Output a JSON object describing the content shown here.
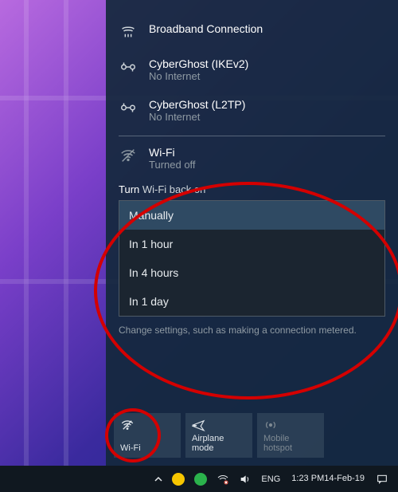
{
  "networks": [
    {
      "name": "Broadband Connection",
      "status": ""
    },
    {
      "name": "CyberGhost (IKEv2)",
      "status": "No Internet"
    },
    {
      "name": "CyberGhost (L2TP)",
      "status": "No Internet"
    }
  ],
  "wifi": {
    "label": "Wi-Fi",
    "status": "Turned off",
    "prompt_prefix": "Turn",
    "prompt_rest": "Wi-Fi back on",
    "options": [
      "Manually",
      "In 1 hour",
      "In 4 hours",
      "In 1 day"
    ],
    "selected": "Manually"
  },
  "settings_line": "Change settings, such as making a connection metered.",
  "tiles": {
    "wifi": "Wi-Fi",
    "airplane": "Airplane mode",
    "hotspot": "Mobile hotspot"
  },
  "tray": {
    "lang": "ENG",
    "time": "1:23 PM",
    "date": "14-Feb-19"
  }
}
